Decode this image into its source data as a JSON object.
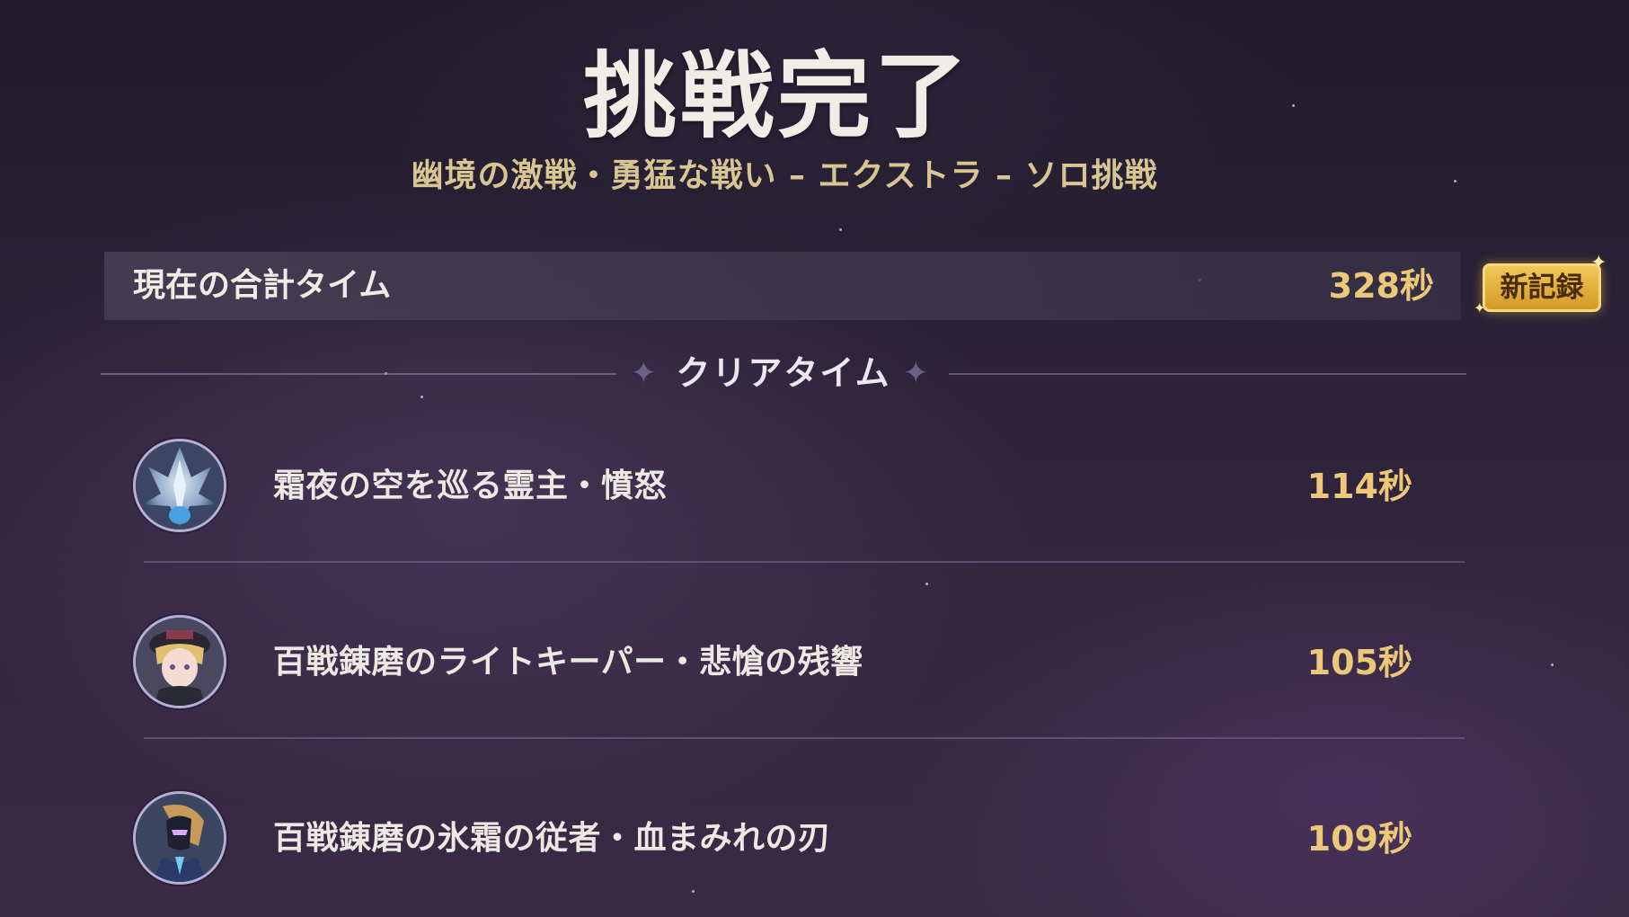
{
  "header": {
    "title": "挑戦完了",
    "subtitle": "幽境の激戦・勇猛な戦い – エクストラ – ソロ挑戦"
  },
  "total": {
    "label": "現在の合計タイム",
    "value": "328秒",
    "badge": "新記録"
  },
  "section": {
    "title": "クリアタイム"
  },
  "entries": [
    {
      "name": "霜夜の空を巡る霊主・憤怒",
      "time": "114秒",
      "icon": "ice-dragon-boss-icon"
    },
    {
      "name": "百戦錬磨のライトキーパー・悲愴の残響",
      "time": "105秒",
      "icon": "lightkeeper-boss-icon"
    },
    {
      "name": "百戦錬磨の氷霜の従者・血まみれの刃",
      "time": "109秒",
      "icon": "frost-attendant-boss-icon"
    }
  ],
  "colors": {
    "accent_gold": "#ecc879",
    "subtitle_gold": "#d8c592",
    "badge_gold": "#f0c75a"
  }
}
